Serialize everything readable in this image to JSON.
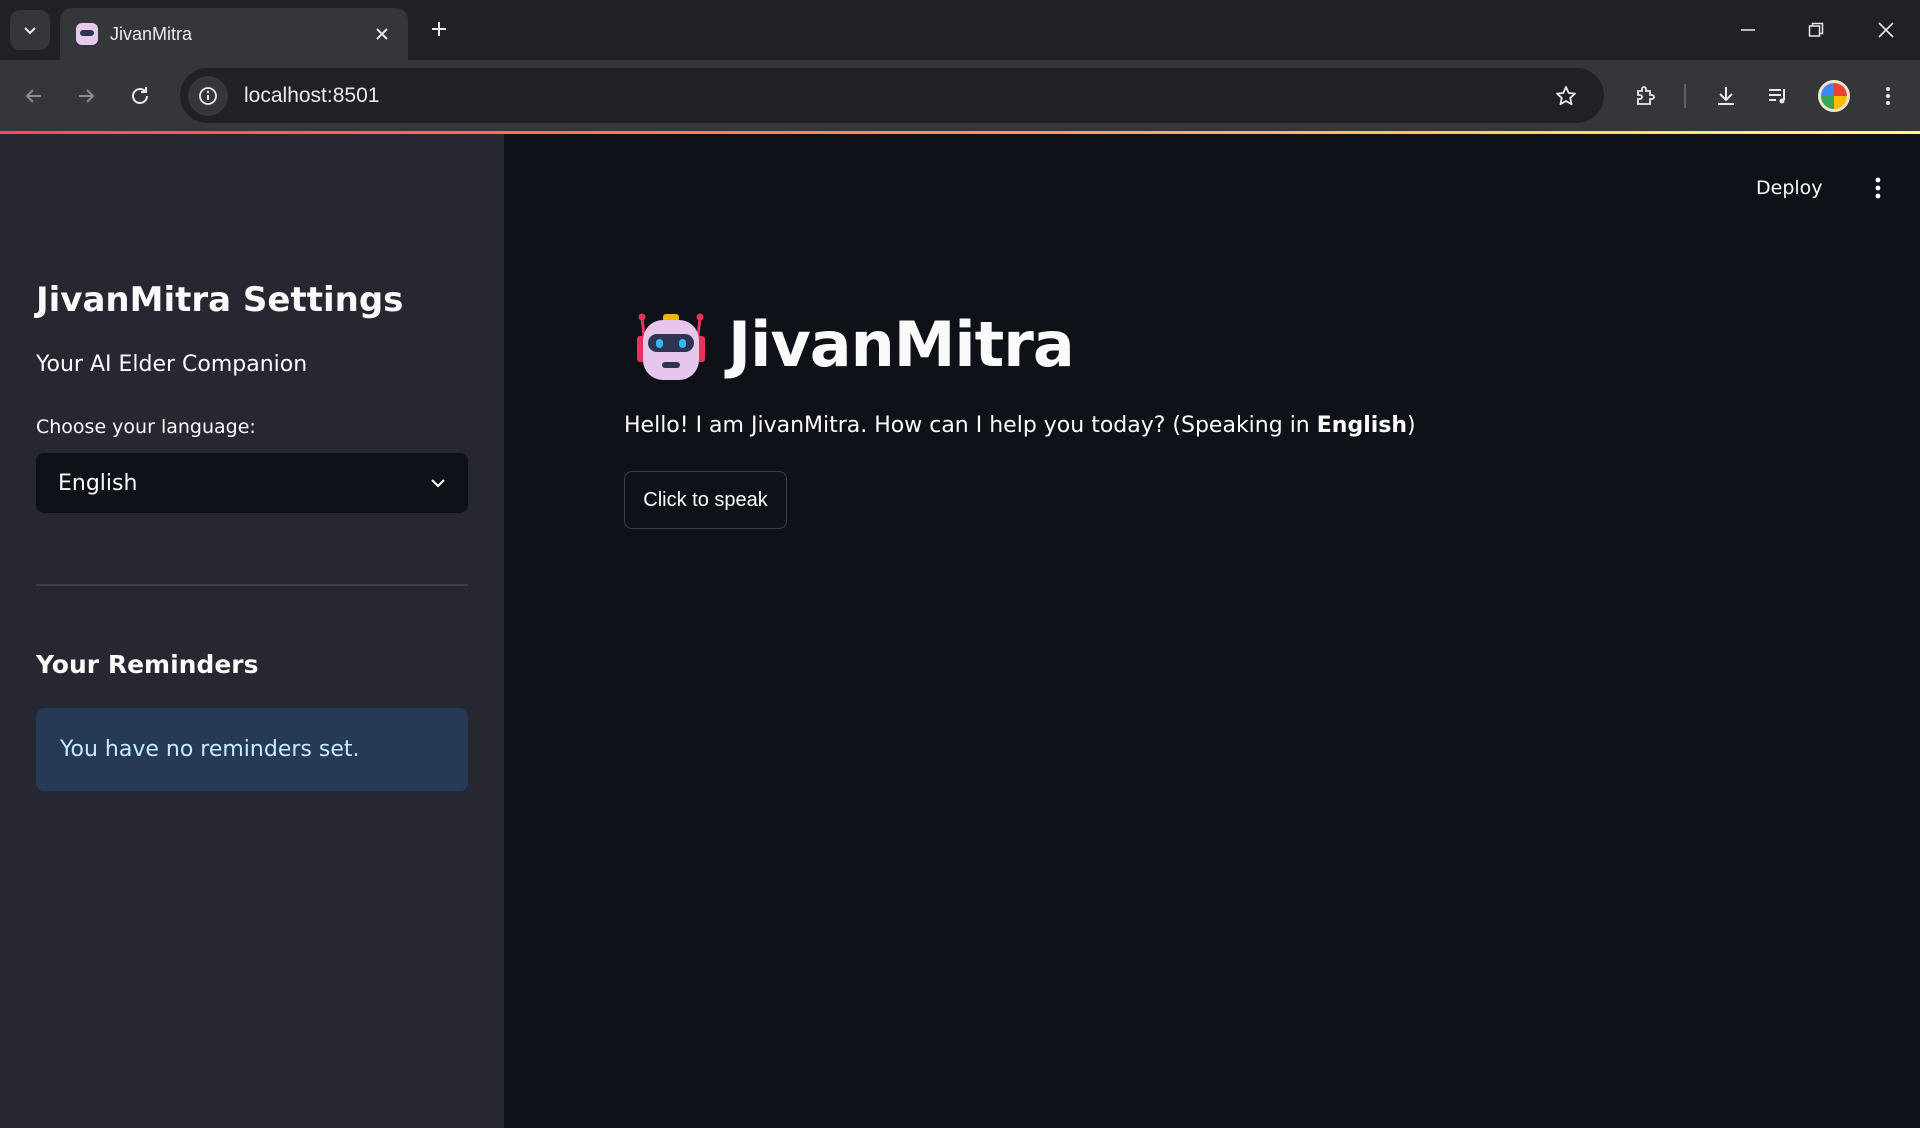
{
  "browser": {
    "tab_title": "JivanMitra",
    "url": "localhost:8501"
  },
  "sidebar": {
    "title": "JivanMitra Settings",
    "subtitle": "Your AI Elder Companion",
    "language_label": "Choose your language:",
    "language_value": "English",
    "reminders_title": "Your Reminders",
    "reminders_info": "You have no reminders set."
  },
  "main": {
    "deploy_label": "Deploy",
    "title_icon": "robot-icon",
    "title": "JivanMitra",
    "greeting_prefix": "Hello! I am JivanMitra. How can I help you today? (Speaking in ",
    "greeting_language": "English",
    "greeting_suffix": ")",
    "speak_button": "Click to speak"
  },
  "colors": {
    "app_background": "#0e1117",
    "sidebar_background": "#262730",
    "info_background": "#263a55",
    "info_text": "#c7ebff",
    "accent": "#ff4b4b"
  }
}
